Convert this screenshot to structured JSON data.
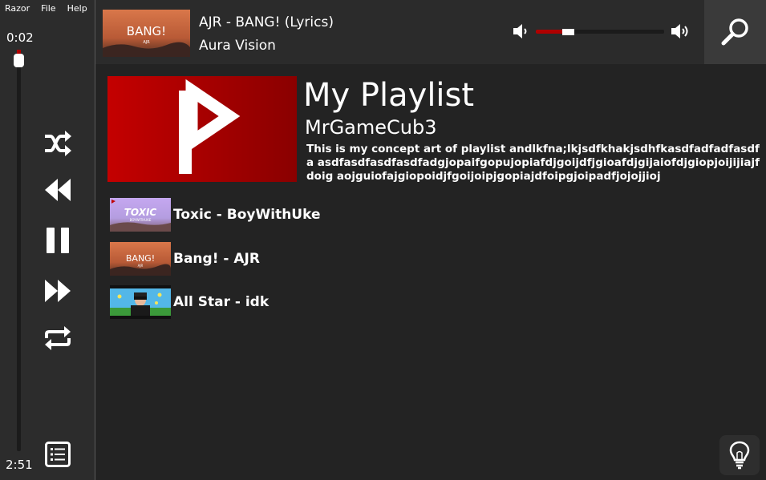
{
  "menu": {
    "items": [
      "Razor",
      "File",
      "Help"
    ]
  },
  "player": {
    "elapsed": "0:02",
    "total": "2:51",
    "progress_fraction": 0.012,
    "now_playing": {
      "title": "AJR - BANG! (Lyrics)",
      "artist": "Aura Vision",
      "thumb_text": "BANG!",
      "thumb_sub": "AJR"
    },
    "volume_fraction": 0.25,
    "controls": [
      "shuffle-icon",
      "rewind-icon",
      "pause-icon",
      "fast-forward-icon",
      "repeat-icon",
      "queue-list-icon"
    ]
  },
  "playlist": {
    "title": "My Playlist",
    "owner": "MrGameCub3",
    "description": "This is my concept art of playlist andlkfna;lkjsdfkhakjsdhfkasdfadfadfasdfa asdfasdfasdfasdfadgjopaifgopujopiafdjgoijdfjgioafdjgijaiofdjgiopjoijijiajfdoig aojguiofajgiopoidjfgoijoipjgopiajdfoipgjoipadfjojojjioj",
    "tracks": [
      {
        "label": "Toxic - BoyWithUke",
        "thumb_text": "TOXIC",
        "thumb_sub": "BOYWITHUKE"
      },
      {
        "label": "Bang! - AJR",
        "thumb_text": "BANG!",
        "thumb_sub": "AJR"
      },
      {
        "label": "All Star - idk",
        "thumb_text": "",
        "thumb_sub": ""
      }
    ]
  },
  "colors": {
    "accent": "#b00000",
    "background": "#232323",
    "sidebar": "#2c2c2c",
    "topbar": "#2b2b2b"
  }
}
